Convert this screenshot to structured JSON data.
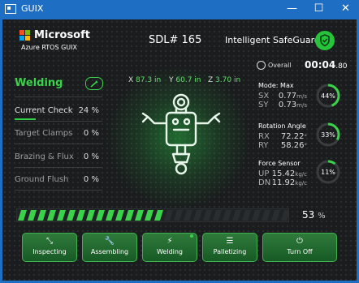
{
  "window": {
    "title": "GUIX",
    "minimize": "—",
    "maximize": "☐",
    "close": "✕"
  },
  "brand": {
    "name": "Microsoft",
    "subtitle": "Azure RTOS GUIX",
    "logo_colors": [
      "#f25022",
      "#7fba00",
      "#00a4ef",
      "#ffb900"
    ]
  },
  "header": {
    "sdl": "SDL# 165",
    "guard": "Intelligent SafeGuard",
    "shield_icon": "shield-check-icon"
  },
  "overall": {
    "label": "Overall",
    "time_main": "00:04",
    "time_frac": ".80"
  },
  "status": {
    "mode": "Welding",
    "icon": "weld-torch-icon"
  },
  "coords": [
    {
      "axis": "X",
      "value": "87.3",
      "unit": "in"
    },
    {
      "axis": "Y",
      "value": "60.7",
      "unit": "in"
    },
    {
      "axis": "Z",
      "value": "3.70",
      "unit": "in"
    }
  ],
  "tasks": [
    {
      "label": "Current Check",
      "pct": "24",
      "unit": "%",
      "progress": 0.24
    },
    {
      "label": "Target Clamps",
      "pct": "0",
      "unit": "%",
      "progress": 0
    },
    {
      "label": "Brazing & Flux",
      "pct": "0",
      "unit": "%",
      "progress": 0
    },
    {
      "label": "Ground Flush",
      "pct": "0",
      "unit": "%",
      "progress": 0
    }
  ],
  "readouts": [
    {
      "title": "Mode: Max",
      "rows": [
        {
          "lab": "SX",
          "val": "0.77",
          "unit": "m/s"
        },
        {
          "lab": "SY",
          "val": "0.73",
          "unit": "m/s"
        }
      ],
      "gauge": "44%",
      "gauge_value": 0.44
    },
    {
      "title": "Rotation Angle",
      "rows": [
        {
          "lab": "RX",
          "val": "72.22",
          "unit": "°"
        },
        {
          "lab": "RY",
          "val": "58.26",
          "unit": "°"
        }
      ],
      "gauge": "33%",
      "gauge_value": 0.33
    },
    {
      "title": "Force Sensor",
      "rows": [
        {
          "lab": "UP",
          "val": "15.42",
          "unit": "kg/c"
        },
        {
          "lab": "DN",
          "val": "11.92",
          "unit": "kg/c"
        }
      ],
      "gauge": "11%",
      "gauge_value": 0.11
    }
  ],
  "progress": {
    "value": 0.53,
    "pct": "53",
    "unit": "%"
  },
  "buttons": [
    {
      "label": "Inspecting",
      "icon": "inspect-icon",
      "glyph": "⤡"
    },
    {
      "label": "Assembling",
      "icon": "wrench-icon",
      "glyph": "🔧"
    },
    {
      "label": "Welding",
      "icon": "bolt-icon",
      "glyph": "⚡"
    },
    {
      "label": "Palletizing",
      "icon": "pallet-icon",
      "glyph": "☰"
    },
    {
      "label": "Turn Off",
      "icon": "power-icon",
      "glyph": "⏻"
    }
  ],
  "colors": {
    "accent": "#3ad24a",
    "titlebar": "#1e6fc4",
    "background": "#1a1c1d"
  }
}
